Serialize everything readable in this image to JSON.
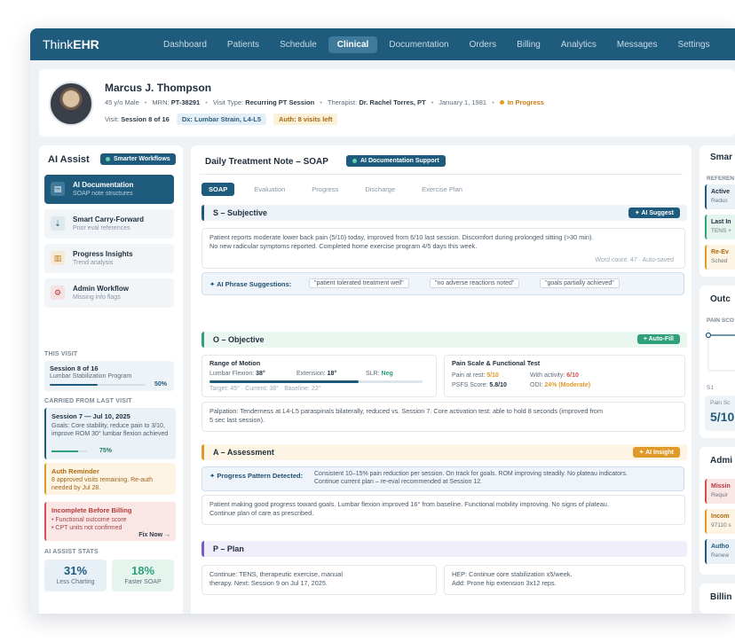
{
  "brand": {
    "prefix": "Think",
    "bold": "EHR"
  },
  "nav": [
    "Dashboard",
    "Patients",
    "Schedule",
    "Clinical",
    "Documentation",
    "Orders",
    "Billing",
    "Analytics",
    "Messages",
    "Settings"
  ],
  "nav_active_index": 3,
  "patient": {
    "name": "Marcus J. Thompson",
    "demo": "45 y/o Male",
    "mrn_label": "MRN:",
    "mrn": "PT-38291",
    "visit_type_label": "Visit Type:",
    "visit_type": "Recurring PT Session",
    "therapist_label": "Therapist:",
    "therapist": "Dr. Rachel Torres, PT",
    "dob": "January 1, 1981",
    "status": "In Progress",
    "visit_label": "Visit:",
    "visit": "Session 8 of 16",
    "dx": "Dx: Lumbar Strain, L4-L5",
    "auth": "Auth: 8 visits left"
  },
  "left": {
    "title": "AI Assist",
    "badge": "Smarter Workflows",
    "menu": [
      {
        "title": "AI Documentation",
        "sub": "SOAP note structures",
        "icon": "document-icon"
      },
      {
        "title": "Smart Carry-Forward",
        "sub": "Prior eval references",
        "icon": "carry-forward-icon"
      },
      {
        "title": "Progress Insights",
        "sub": "Trend analysis",
        "icon": "chart-icon"
      },
      {
        "title": "Admin Workflow",
        "sub": "Missing info flags",
        "icon": "workflow-icon"
      }
    ],
    "this_visit_label": "THIS VISIT",
    "visit_title": "Session 8 of 16",
    "visit_sub": "Lumbar Stabilization Program",
    "visit_pct": "50%",
    "visit_progress": 0.5,
    "carried_label": "CARRIED FROM LAST VISIT",
    "carry_title": "Session 7 — Jul 10, 2025",
    "carry_text": "Goals: Core stability, reduce pain to 3/10, improve ROM 30° lumbar flexion achieved",
    "carry_pct": "75%",
    "carry_progress": 0.75,
    "auth_title": "Auth Reminder",
    "auth_text": "8 approved visits remaining. Re-auth needed by Jul 28.",
    "billing_title": "Incomplete Before Billing",
    "billing_items": [
      "• Functional outcome score",
      "• CPT units not confirmed"
    ],
    "billing_action": "Fix Now →",
    "stats_label": "AI ASSIST STATS",
    "stats": [
      {
        "value": "31%",
        "label": "Less Charting"
      },
      {
        "value": "18%",
        "label": "Faster SOAP"
      }
    ]
  },
  "note": {
    "title": "Daily Treatment Note – SOAP",
    "badge": "AI Documentation Support",
    "tabs": [
      "SOAP",
      "Evaluation",
      "Progress",
      "Discharge",
      "Exercise Plan"
    ],
    "subjective": {
      "title": "S – Subjective",
      "button": "✦ AI Suggest",
      "text1": "Patient reports moderate lower back pain (5/10) today, improved from 6/10 last session. Discomfort during prolonged sitting (>30 min).",
      "text2": "No new radicular symptoms reported. Completed home exercise program 4/5 days this week.",
      "meta": "Word count: 47 · Auto-saved",
      "phrase_label": "✦ AI Phrase Suggestions:",
      "phrases": [
        "\"patient tolerated treatment well\"",
        "\"no adverse reactions noted\"",
        "\"goals partially achieved\""
      ]
    },
    "objective": {
      "title": "O – Objective",
      "button": "+ Auto-Fill",
      "rom_title": "Range of Motion",
      "lumbar_label": "Lumbar Flexion:",
      "lumbar": "38°",
      "extension_label": "Extension:",
      "extension": "18°",
      "slr_label": "SLR:",
      "slr": "Neg",
      "target": "Target: 45° · Current: 38° · Baseline: 22°",
      "rom_progress": 0.7,
      "pain_title": "Pain Scale & Functional Test",
      "rest_label": "Pain at rest:",
      "rest": "5/10",
      "activity_label": "With activity:",
      "activity": "6/10",
      "psfs_label": "PSFS Score:",
      "psfs": "5.8/10",
      "odi_label": "ODI:",
      "odi": "24% (Moderate)",
      "palpation1": "Palpation: Tenderness at L4-L5 paraspinals bilaterally, reduced vs. Session 7. Core activation test: able to hold 8 seconds (improved from",
      "palpation2": "5 sec last session)."
    },
    "assessment": {
      "title": "A – Assessment",
      "button": "✦ AI Insight",
      "pattern_label": "✦ Progress Pattern Detected:",
      "pattern1": "Consistent 10–15% pain reduction per session. On track for goals. ROM improving steadily. No plateau indicators.",
      "pattern2": "Continue current plan – re-eval recommended at Session 12.",
      "text1": "Patient making good progress toward goals. Lumbar flexion improved 16° from baseline. Functional mobility improving. No signs of plateau.",
      "text2": "Continue plan of care as prescribed."
    },
    "plan": {
      "title": "P – Plan",
      "left1": "Continue: TENS, therapeutic exercise, manual",
      "left2": "therapy. Next: Session 9 on Jul 17, 2025.",
      "right1": "HEP: Continue core stabilization x5/week.",
      "right2": "Add: Prone hip extension 3x12 reps."
    }
  },
  "right": {
    "smart_title": "Smar",
    "ref_label": "REFEREN",
    "items": [
      {
        "a": "Active",
        "b": "Reduc"
      },
      {
        "a": "Last In",
        "b": "TENS +"
      },
      {
        "a": "Re-Ev",
        "b": "Sched"
      }
    ],
    "outcome_title": "Outc",
    "pain_label": "PAIN SCO",
    "chart_tick": "S1",
    "pain_small": "Pain Sc",
    "pain_value": "5/10",
    "admin_title": "Admi",
    "admin_items": [
      {
        "a": "Missin",
        "b": "Requir"
      },
      {
        "a": "Incom",
        "b": "97110 s"
      },
      {
        "a": "Autho",
        "b": "Renew"
      }
    ],
    "billing_title": "Billin"
  },
  "colors": {
    "primary": "#1f5b7c",
    "success": "#2ea07a",
    "warning": "#e09a2a",
    "danger": "#d05050"
  }
}
